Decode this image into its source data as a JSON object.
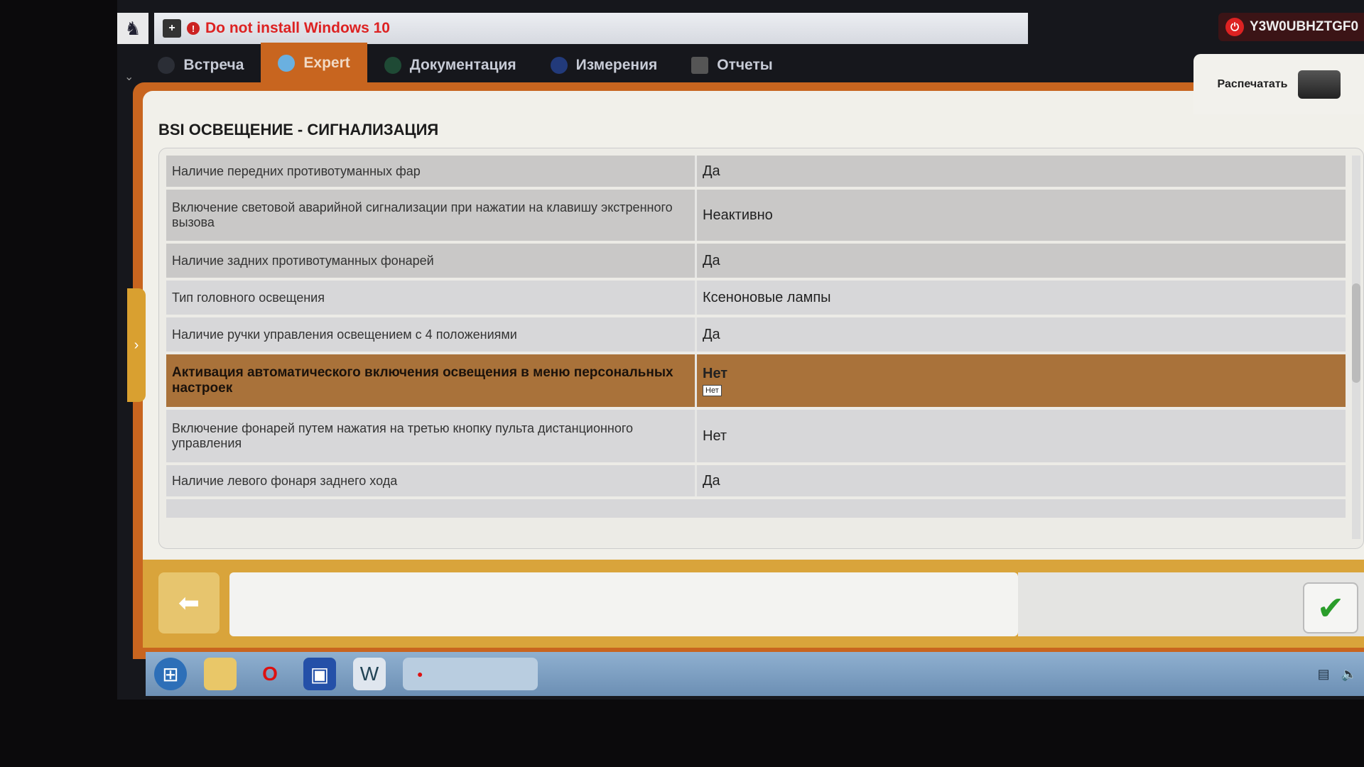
{
  "titlebar": {
    "warning": "Do not install Windows 10",
    "vin": "Y3W0UBHZTGF0"
  },
  "tabs": [
    {
      "label": "Встреча"
    },
    {
      "label": "Expert",
      "active": true
    },
    {
      "label": "Документация"
    },
    {
      "label": "Измерения"
    },
    {
      "label": "Отчеты"
    }
  ],
  "print_label": "Распечатать",
  "panel_title": "BSI  ОСВЕЩЕНИЕ - СИГНАЛИЗАЦИЯ",
  "rows": [
    {
      "label": "Наличие передних противотуманных фар",
      "value": "Да"
    },
    {
      "label": "Включение световой аварийной сигнализации при нажатии на клавишу экстренного вызова",
      "value": "Неактивно"
    },
    {
      "label": "Наличие задних противотуманных фонарей",
      "value": "Да"
    },
    {
      "label": "Тип головного освещения",
      "value": "Ксеноновые лампы"
    },
    {
      "label": "Наличие ручки управления освещением с 4 положениями",
      "value": "Да"
    },
    {
      "label": "Активация автоматического включения освещения в меню персональных настроек",
      "value": "Нет",
      "tooltip": "Нет",
      "selected": true
    },
    {
      "label": "Включение фонарей путем нажатия на третью кнопку пульта дистанционного управления",
      "value": "Нет"
    },
    {
      "label": "Наличие левого фонаря заднего хода",
      "value": "Да"
    }
  ],
  "colors": {
    "accent": "#c8651f",
    "selected_row": "#a9723a",
    "warning": "#dd2222"
  },
  "icons": {
    "back": "arrow-left",
    "confirm": "checkmark",
    "print": "printer"
  }
}
